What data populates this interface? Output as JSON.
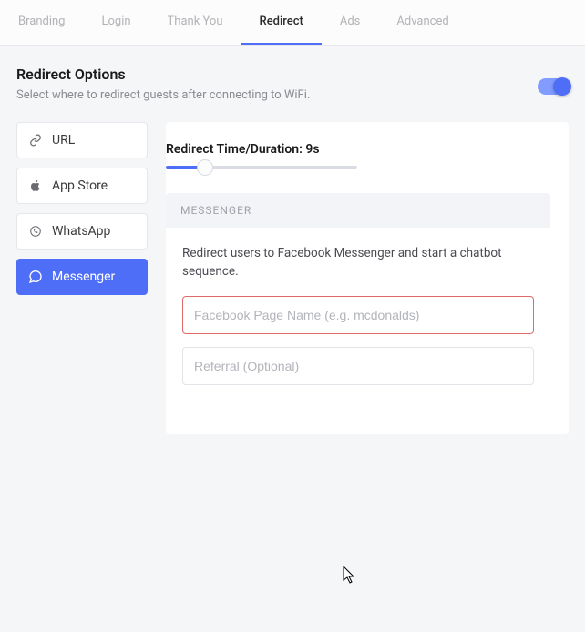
{
  "tabs": [
    {
      "label": "Branding"
    },
    {
      "label": "Login"
    },
    {
      "label": "Thank You"
    },
    {
      "label": "Redirect"
    },
    {
      "label": "Ads"
    },
    {
      "label": "Advanced"
    }
  ],
  "header": {
    "title": "Redirect Options",
    "subtitle": "Select where to redirect guests after connecting to WiFi."
  },
  "sidebar": [
    {
      "label": "URL"
    },
    {
      "label": "App Store"
    },
    {
      "label": "WhatsApp"
    },
    {
      "label": "Messenger"
    }
  ],
  "slider": {
    "label_prefix": "Redirect Time/Duration: ",
    "value": "9s"
  },
  "panel": {
    "title": "MESSENGER",
    "description": "Redirect users to Facebook Messenger and start a chatbot sequence.",
    "field1_placeholder": "Facebook Page Name (e.g. mcdonalds)",
    "field2_placeholder": "Referral (Optional)"
  }
}
